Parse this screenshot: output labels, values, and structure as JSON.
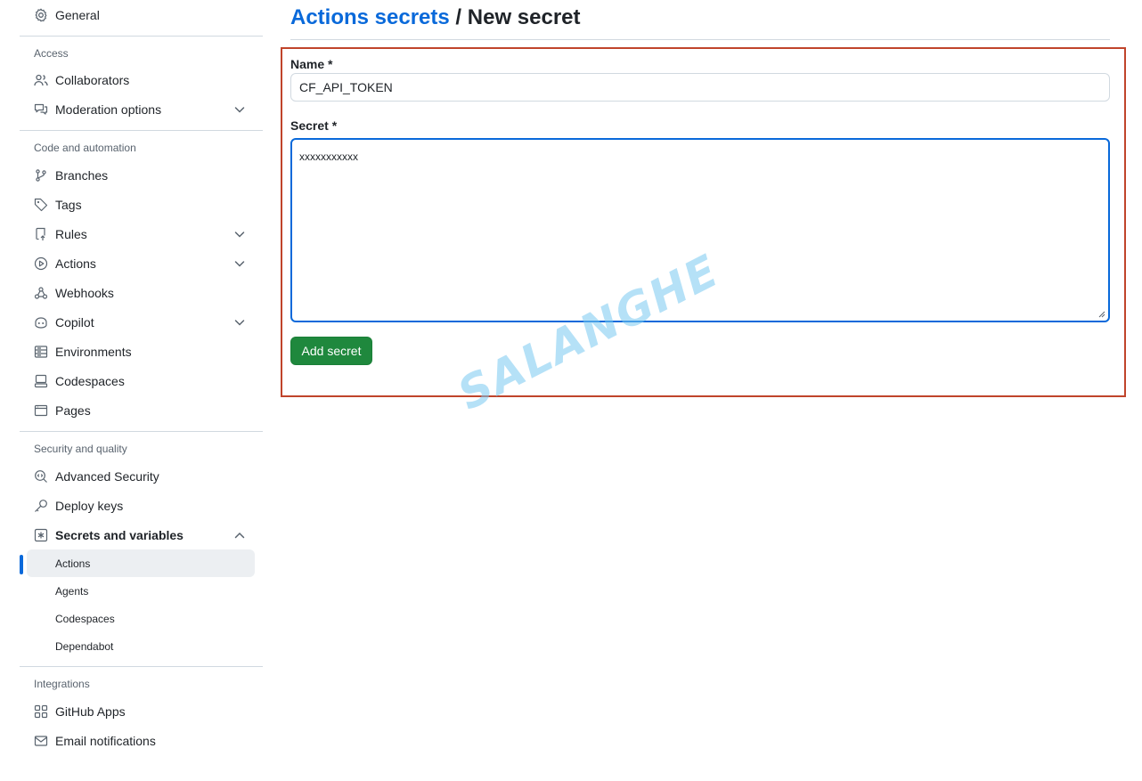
{
  "sidebar": {
    "general": {
      "label": "General",
      "icon": "gear-icon"
    },
    "access": {
      "title": "Access",
      "items": [
        {
          "label": "Collaborators",
          "icon": "people-icon"
        },
        {
          "label": "Moderation options",
          "icon": "comment-discussion-icon",
          "expandable": true
        }
      ]
    },
    "code_automation": {
      "title": "Code and automation",
      "items": [
        {
          "label": "Branches",
          "icon": "git-branch-icon"
        },
        {
          "label": "Tags",
          "icon": "tag-icon"
        },
        {
          "label": "Rules",
          "icon": "repo-push-icon",
          "expandable": true
        },
        {
          "label": "Actions",
          "icon": "play-icon",
          "expandable": true
        },
        {
          "label": "Webhooks",
          "icon": "webhook-icon"
        },
        {
          "label": "Copilot",
          "icon": "copilot-icon",
          "expandable": true
        },
        {
          "label": "Environments",
          "icon": "server-icon"
        },
        {
          "label": "Codespaces",
          "icon": "codespaces-icon"
        },
        {
          "label": "Pages",
          "icon": "browser-icon"
        }
      ]
    },
    "security": {
      "title": "Security and quality",
      "items": [
        {
          "label": "Advanced Security",
          "icon": "codescan-icon"
        },
        {
          "label": "Deploy keys",
          "icon": "key-icon"
        },
        {
          "label": "Secrets and variables",
          "icon": "asterisk-icon",
          "expanded": true
        }
      ],
      "subitems": [
        {
          "label": "Actions",
          "active": true
        },
        {
          "label": "Agents"
        },
        {
          "label": "Codespaces"
        },
        {
          "label": "Dependabot"
        }
      ]
    },
    "integrations": {
      "title": "Integrations",
      "items": [
        {
          "label": "GitHub Apps",
          "icon": "apps-icon"
        },
        {
          "label": "Email notifications",
          "icon": "mail-icon"
        }
      ]
    }
  },
  "main": {
    "breadcrumb_link": "Actions secrets",
    "breadcrumb_sep": "/",
    "page_title": "New secret",
    "name_label": "Name *",
    "name_value": "CF_API_TOKEN",
    "secret_label": "Secret *",
    "secret_value": "xxxxxxxxxxx",
    "submit_label": "Add secret"
  },
  "watermark": "SALANGHE",
  "colors": {
    "accent": "#0969da",
    "button_green": "#1f883d",
    "highlight_border": "#c0442b"
  }
}
